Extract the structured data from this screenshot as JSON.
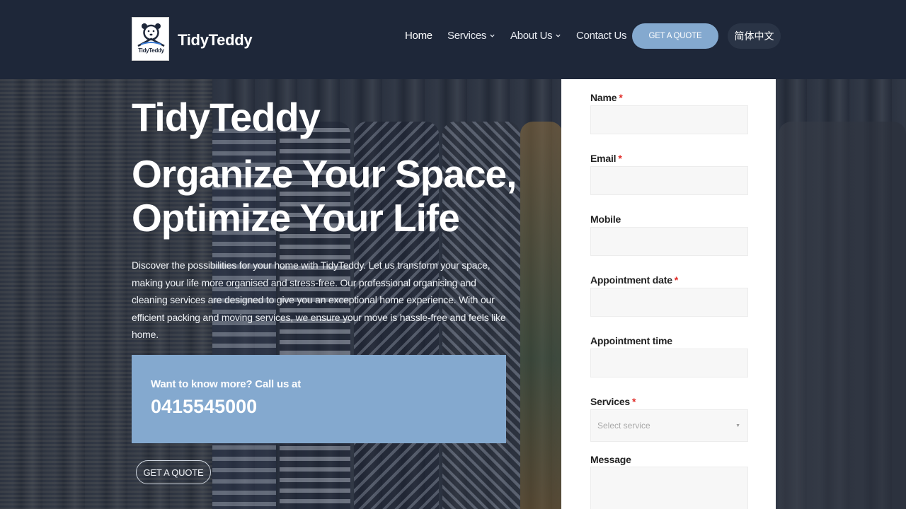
{
  "header": {
    "brand": "TidyTeddy",
    "logo_text": "TidyTeddy",
    "nav": [
      {
        "label": "Home",
        "has_dropdown": false
      },
      {
        "label": "Services",
        "has_dropdown": true
      },
      {
        "label": "About Us",
        "has_dropdown": true
      },
      {
        "label": "Contact Us",
        "has_dropdown": false
      }
    ],
    "quote_button": "GET A QUOTE",
    "language_button": "简体中文"
  },
  "hero": {
    "title": "TidyTeddy",
    "headline_line1": "Organize Your Space,",
    "headline_line2": "Optimize Your Life",
    "description": "Discover the possibilities for your home with TidyTeddy. Let us transform your space, making your life more organised and stress-free. Our professional organising and cleaning services are designed to give you an exceptional home experience. With our efficient packing and moving services, we ensure your move is hassle-free and feels like home.",
    "call_label": "Want to know more? Call us at",
    "call_number": "0415545000",
    "quote_button": "GET A QUOTE"
  },
  "form": {
    "fields": [
      {
        "label": "Name",
        "required": true
      },
      {
        "label": "Email",
        "required": true
      },
      {
        "label": "Mobile",
        "required": false
      },
      {
        "label": "Appointment date",
        "required": true
      },
      {
        "label": "Appointment time",
        "required": false
      },
      {
        "label": "Services",
        "required": true
      },
      {
        "label": "Message",
        "required": false
      }
    ],
    "services_placeholder": "Select service",
    "required_marker": "*"
  },
  "colors": {
    "header_bg": "#1e2739",
    "accent": "#84a9cf",
    "required": "#e02b27"
  }
}
